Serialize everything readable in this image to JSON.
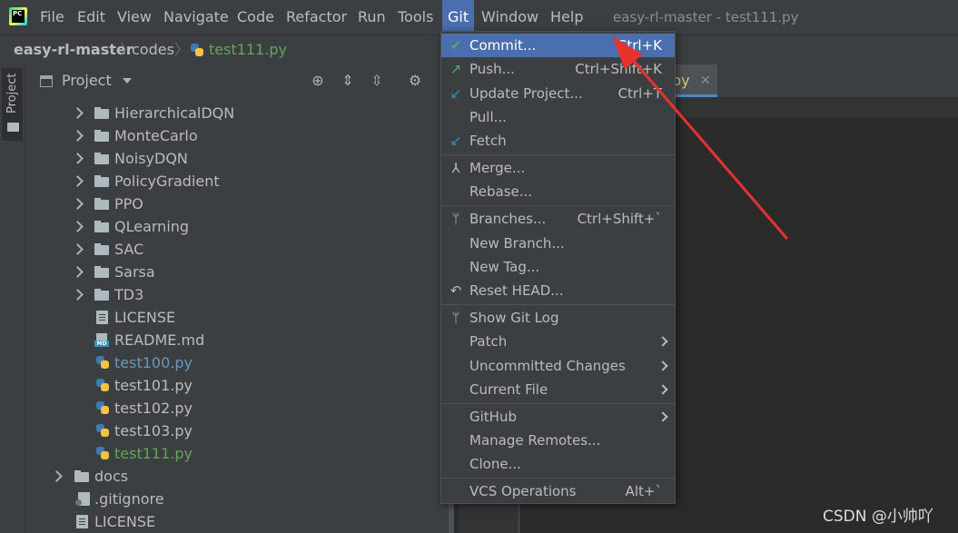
{
  "menubar": {
    "items": [
      {
        "label": "File"
      },
      {
        "label": "Edit"
      },
      {
        "label": "View"
      },
      {
        "label": "Navigate"
      },
      {
        "label": "Code"
      },
      {
        "label": "Refactor"
      },
      {
        "label": "Run"
      },
      {
        "label": "Tools"
      },
      {
        "label": "Git"
      },
      {
        "label": "Window"
      },
      {
        "label": "Help"
      }
    ],
    "window_title": "easy-rl-master - test111.py"
  },
  "navbar": {
    "crumbs": [
      {
        "label": "easy-rl-master"
      },
      {
        "label": "codes"
      },
      {
        "label": "test111.py"
      }
    ]
  },
  "sidebar": {
    "project_tab": "Project"
  },
  "project_panel": {
    "title": "Project",
    "tree": [
      {
        "label": "HierarchicalDQN",
        "kind": "folder"
      },
      {
        "label": "MonteCarlo",
        "kind": "folder"
      },
      {
        "label": "NoisyDQN",
        "kind": "folder"
      },
      {
        "label": "PolicyGradient",
        "kind": "folder"
      },
      {
        "label": "PPO",
        "kind": "folder"
      },
      {
        "label": "QLearning",
        "kind": "folder"
      },
      {
        "label": "SAC",
        "kind": "folder"
      },
      {
        "label": "Sarsa",
        "kind": "folder"
      },
      {
        "label": "TD3",
        "kind": "folder"
      },
      {
        "label": "LICENSE",
        "kind": "file"
      },
      {
        "label": "README.md",
        "kind": "md"
      },
      {
        "label": "test100.py",
        "kind": "py"
      },
      {
        "label": "test101.py",
        "kind": "py"
      },
      {
        "label": "test102.py",
        "kind": "py"
      },
      {
        "label": "test103.py",
        "kind": "py"
      },
      {
        "label": "test111.py",
        "kind": "py"
      },
      {
        "label": "docs",
        "kind": "folder"
      },
      {
        "label": ".gitignore",
        "kind": "git"
      },
      {
        "label": "LICENSE",
        "kind": "file"
      }
    ]
  },
  "editor": {
    "tab_label": "py",
    "tab_close": "✕"
  },
  "git_menu": {
    "items": [
      {
        "label": "Commit...",
        "shortcut": "Ctrl+K",
        "icon": "check-icon"
      },
      {
        "label": "Push...",
        "shortcut": "Ctrl+Shift+K",
        "icon": "push-arrow-icon"
      },
      {
        "label": "Update Project...",
        "shortcut": "Ctrl+T",
        "icon": "update-arrow-icon"
      },
      {
        "label": "Pull...",
        "shortcut": ""
      },
      {
        "label": "Fetch",
        "shortcut": "",
        "icon": "fetch-icon"
      },
      {
        "label": "Merge...",
        "shortcut": "",
        "icon": "merge-icon"
      },
      {
        "label": "Rebase...",
        "shortcut": ""
      },
      {
        "label": "Branches...",
        "shortcut": "Ctrl+Shift+`",
        "icon": "branch-icon"
      },
      {
        "label": "New Branch...",
        "shortcut": ""
      },
      {
        "label": "New Tag...",
        "shortcut": ""
      },
      {
        "label": "Reset HEAD...",
        "shortcut": "",
        "icon": "undo-icon"
      },
      {
        "label": "Show Git Log",
        "shortcut": "",
        "icon": "git-log-icon"
      },
      {
        "label": "Patch",
        "shortcut": ""
      },
      {
        "label": "Uncommitted Changes",
        "shortcut": ""
      },
      {
        "label": "Current File",
        "shortcut": ""
      },
      {
        "label": "GitHub",
        "shortcut": ""
      },
      {
        "label": "Manage Remotes...",
        "shortcut": ""
      },
      {
        "label": "Clone...",
        "shortcut": ""
      },
      {
        "label": "VCS Operations",
        "shortcut": "Alt+`"
      }
    ]
  },
  "watermark": "CSDN @小帅吖",
  "colors": {
    "menu_highlight": "#4b6eaf",
    "annotation_arrow": "#e8322e",
    "py_green": "#62a45b",
    "py_blue": "#6897bb"
  }
}
